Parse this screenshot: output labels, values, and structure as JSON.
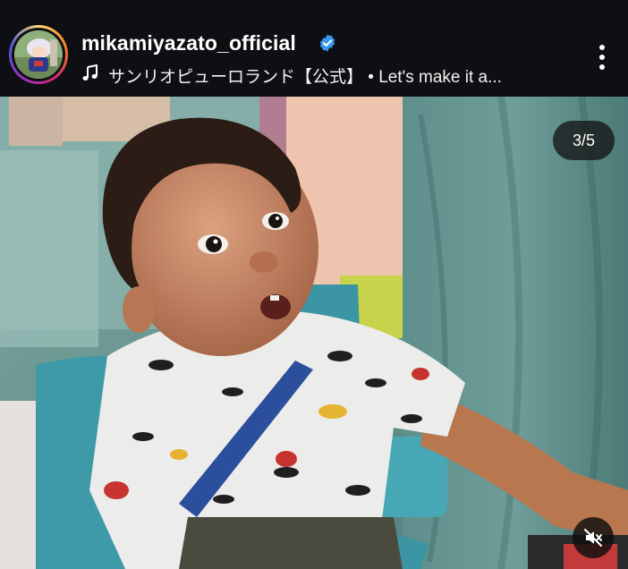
{
  "header": {
    "username": "mikamiyazato_official",
    "music_line": "サンリオピューロランド【公式】 • Let's make it a...",
    "verified": true
  },
  "carousel": {
    "counter": "3/5"
  },
  "icons": [
    "verified-icon",
    "music-note-icon",
    "more-options-icon",
    "mute-icon"
  ],
  "colors": {
    "header_bg": "#0d0f12",
    "verified_blue": "#3897f0",
    "ring": [
      "#feda75",
      "#fa7e1e",
      "#d62976",
      "#962fbf",
      "#4f5bd5"
    ]
  }
}
